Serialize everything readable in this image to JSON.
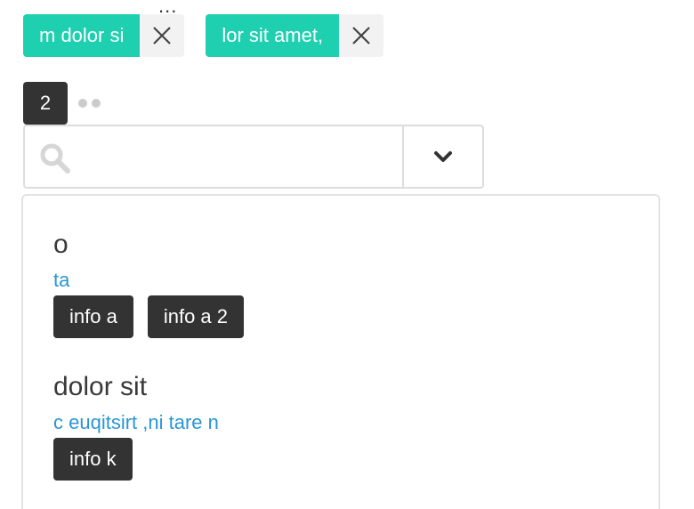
{
  "top": {
    "overflow_dots": "..."
  },
  "chips": [
    {
      "label": "m dolor si",
      "remove_icon": "close-icon"
    },
    {
      "label": "lor sit amet,",
      "remove_icon": "close-icon"
    }
  ],
  "pager": {
    "current": "2",
    "dots": 2
  },
  "search": {
    "value": "",
    "placeholder": "",
    "icon": "search-icon",
    "toggle_icon": "chevron-down-icon"
  },
  "results": [
    {
      "title": "o",
      "subtitle": "ta",
      "tags": [
        "info a",
        "info a 2"
      ]
    },
    {
      "title": "dolor sit",
      "subtitle": "c euqitsirt ,ni tare n",
      "tags": [
        "info k"
      ]
    }
  ],
  "colors": {
    "accent": "#1ecfb0",
    "dark": "#333333",
    "link": "#2a96d6",
    "border": "#dddddd"
  }
}
